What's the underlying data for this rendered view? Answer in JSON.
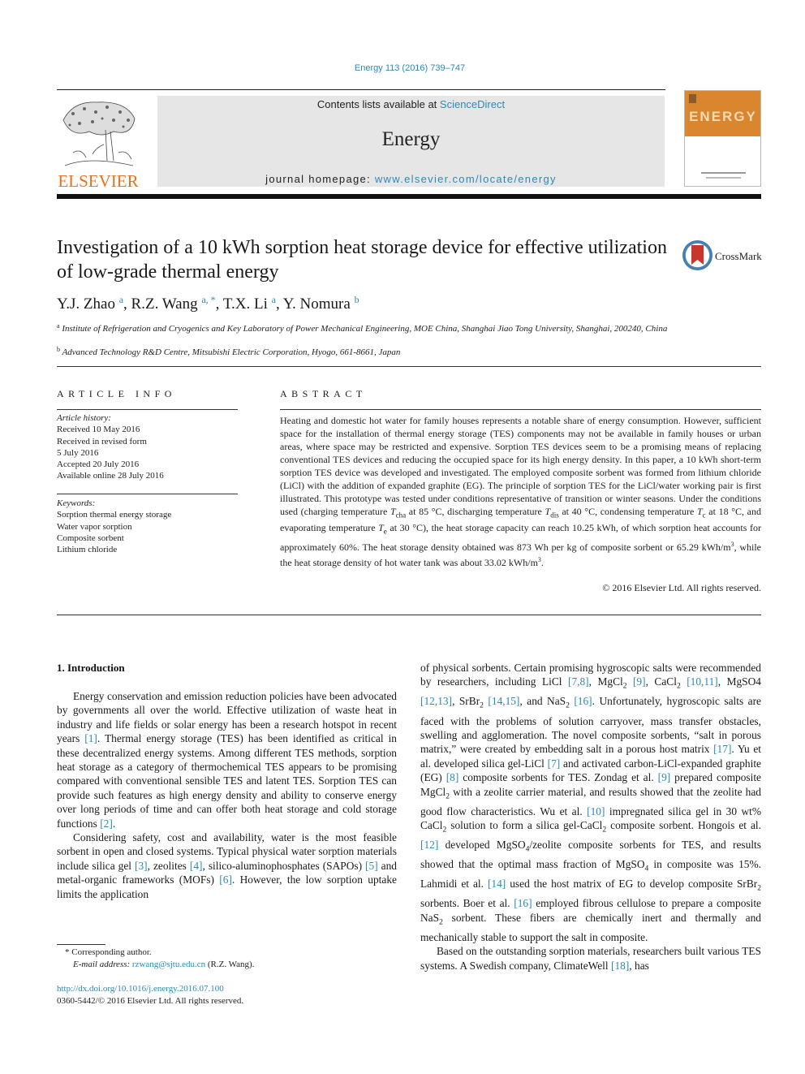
{
  "header": {
    "citation": "Energy 113 (2016) 739–747",
    "contents_prefix": "Contents lists available at ",
    "contents_link": "ScienceDirect",
    "journal_name": "Energy",
    "homepage_prefix": "journal homepage: ",
    "homepage_link": "www.elsevier.com/locate/energy",
    "publisher_logo_text": "ELSEVIER",
    "cover_title": "ENERGY",
    "brand_orange": "#e9711c",
    "link_color": "#2a8ab8"
  },
  "article": {
    "title": "Investigation of a 10 kWh sorption heat storage device for effective utilization of low-grade thermal energy",
    "crossmark_label": "CrossMark",
    "authors": [
      {
        "name": "Y.J. Zhao",
        "sup": "a"
      },
      {
        "name": "R.Z. Wang",
        "sup": "a, *"
      },
      {
        "name": "T.X. Li",
        "sup": "a"
      },
      {
        "name": "Y. Nomura",
        "sup": "b"
      }
    ],
    "affiliations": [
      {
        "mark": "a",
        "text": "Institute of Refrigeration and Cryogenics and Key Laboratory of Power Mechanical Engineering, MOE China, Shanghai Jiao Tong University, Shanghai, 200240, China"
      },
      {
        "mark": "b",
        "text": "Advanced Technology R&D Centre, Mitsubishi Electric Corporation, Hyogo, 661-8661, Japan"
      }
    ]
  },
  "article_info": {
    "heading": "ARTICLE INFO",
    "history_label": "Article history:",
    "history": [
      "Received 10 May 2016",
      "Received in revised form",
      "5 July 2016",
      "Accepted 20 July 2016",
      "Available online 28 July 2016"
    ],
    "keywords_label": "Keywords:",
    "keywords": [
      "Sorption thermal energy storage",
      "Water vapor sorption",
      "Composite sorbent",
      "Lithium chloride"
    ]
  },
  "abstract": {
    "heading": "ABSTRACT",
    "p1": "Heating and domestic hot water for family houses represents a notable share of energy consumption. However, sufficient space for the installation of thermal energy storage (TES) components may not be available in family houses or urban areas, where space may be restricted and expensive. Sorption TES devices seem to be a promising means of replacing conventional TES devices and reducing the occupied space for its high energy density. In this paper, a 10 kWh short-term sorption TES device was developed and investigated. The employed composite sorbent was formed from lithium chloride (LiCl) with the addition of expanded graphite (EG). The principle of sorption TES for the LiCl/water working pair is first illustrated. This prototype was tested under conditions representative of transition or winter seasons. Under the conditions used (charging temperature ",
    "t_cha": "T",
    "t_cha_sub": "cha",
    "p2": " at 85 °C, discharging temperature ",
    "t_dis": "T",
    "t_dis_sub": "dis",
    "p3": " at 40 °C, condensing temperature ",
    "t_c": "T",
    "t_c_sub": "c",
    "p4": " at 18 °C, and evaporating temperature ",
    "t_e": "T",
    "t_e_sub": "e",
    "p5": " at 30 °C), the heat storage capacity can reach 10.25 kWh, of which sorption heat accounts for approximately 60%. The heat storage density obtained was 873 Wh per kg of composite sorbent or 65.29 kWh/m",
    "sup1": "3",
    "p6": ", while the heat storage density of hot water tank was about 33.02 kWh/m",
    "sup2": "3",
    "p7": ".",
    "copyright": "© 2016 Elsevier Ltd. All rights reserved."
  },
  "intro": {
    "heading": "1.  Introduction",
    "left": {
      "a1": "Energy conservation and emission reduction policies have been advocated by governments all over the world. Effective utilization of waste heat in industry and life fields or solar energy has been a research hotspot in recent years ",
      "r1": "[1]",
      "a2": ". Thermal energy storage (TES) has been identified as critical in these decentralized energy systems. Among different TES methods, sorption heat storage as a category of thermochemical TES appears to be promising compared with conventional sensible TES and latent TES. Sorption TES can provide such features as high energy density and ability to conserve energy over long periods of time and can offer both heat storage and cold storage functions ",
      "r2": "[2]",
      "a3": ".",
      "b1": "Considering safety, cost and availability, water is the most feasible sorbent in open and closed systems. Typical physical water sorption materials include silica gel ",
      "r3": "[3]",
      "b2": ", zeolites ",
      "r4": "[4]",
      "b3": ", silico-aluminophosphates (SAPOs) ",
      "r5": "[5]",
      "b4": " and metal-organic frameworks (MOFs) ",
      "r6": "[6]",
      "b5": ". However, the low sorption uptake limits the application"
    },
    "right": {
      "c1": "of physical sorbents. Certain promising hygroscopic salts were recommended by researchers, including LiCl ",
      "r78": "[7,8]",
      "c2": ", MgCl",
      "c2s": "2",
      "r9": "[9]",
      "c3": ", CaCl",
      "c3s": "2",
      "r1011": "[10,11]",
      "c4": ", MgSO4 ",
      "r1213": "[12,13]",
      "c5": ", SrBr",
      "c5s": "2",
      "r1415": "[14,15]",
      "c6": ", and NaS",
      "c6s": "2",
      "r16": "[16]",
      "c7": ". Unfortunately, hygroscopic salts are faced with the problems of solution carryover, mass transfer obstacles, swelling and agglomeration. The novel composite sorbents, “salt in porous matrix,” were created by embedding salt in a porous host matrix ",
      "r17": "[17]",
      "c8": ". Yu et al. developed silica gel-LiCl ",
      "r7": "[7]",
      "c9": " and activated carbon-LiCl-expanded graphite (EG) ",
      "r8": "[8]",
      "c10": " composite sorbents for TES. Zondag et al. ",
      "r9b": "[9]",
      "c11": " prepared composite MgCl",
      "c11s": "2",
      "c12": " with a zeolite carrier material, and results showed that the zeolite had good flow characteristics. Wu et al. ",
      "r10": "[10]",
      "c13": " impregnated silica gel in 30 wt% CaCl",
      "c13s": "2",
      "c14": " solution to form a silica gel-CaCl",
      "c14s": "2",
      "c15": " composite sorbent. Hongois et al. ",
      "r12": "[12]",
      "c16": " developed MgSO",
      "c16s": "4",
      "c17": "/zeolite composite sorbents for TES, and results showed that the optimal mass fraction of MgSO",
      "c17s": "4",
      "c18": " in composite was 15%. Lahmidi et al. ",
      "r14": "[14]",
      "c19": " used the host matrix of EG to develop composite SrBr",
      "c19s": "2",
      "c20": " sorbents. Boer et al. ",
      "r16b": "[16]",
      "c21": " employed fibrous cellulose to prepare a composite NaS",
      "c21s": "2",
      "c22": " sorbent. These fibers are chemically inert and thermally and mechanically stable to support the salt in composite.",
      "d1": "Based on the outstanding sorption materials, researchers built various TES systems. A Swedish company, ClimateWell ",
      "r18": "[18]",
      "d2": ", has"
    }
  },
  "footnotes": {
    "corresponding": "* Corresponding author.",
    "email_label": "E-mail address: ",
    "email": "rzwang@sjtu.edu.cn",
    "email_suffix": " (R.Z. Wang).",
    "doi": "http://dx.doi.org/10.1016/j.energy.2016.07.100",
    "issn": "0360-5442/© 2016 Elsevier Ltd. All rights reserved."
  }
}
